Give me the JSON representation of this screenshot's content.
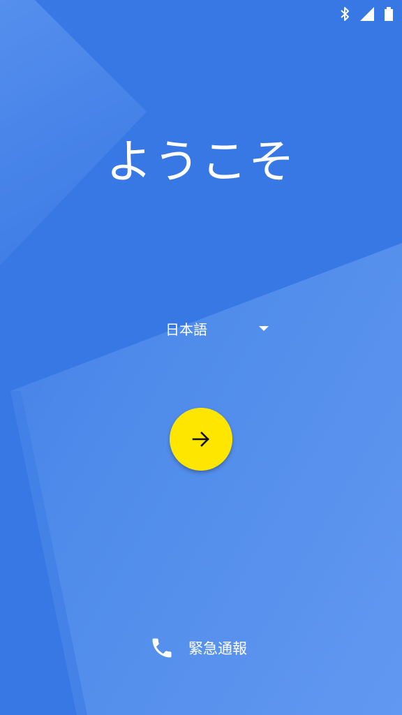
{
  "status_bar": {
    "icons": [
      "bluetooth-icon",
      "signal-icon",
      "battery-icon"
    ]
  },
  "welcome": {
    "title": "ようこそ"
  },
  "language": {
    "selected": "日本語"
  },
  "next_button": {
    "icon": "arrow-right-icon",
    "color": "#ffe600"
  },
  "emergency": {
    "icon": "phone-icon",
    "label": "緊急通報"
  },
  "colors": {
    "background": "#3878e4",
    "accent": "#ffe600"
  }
}
